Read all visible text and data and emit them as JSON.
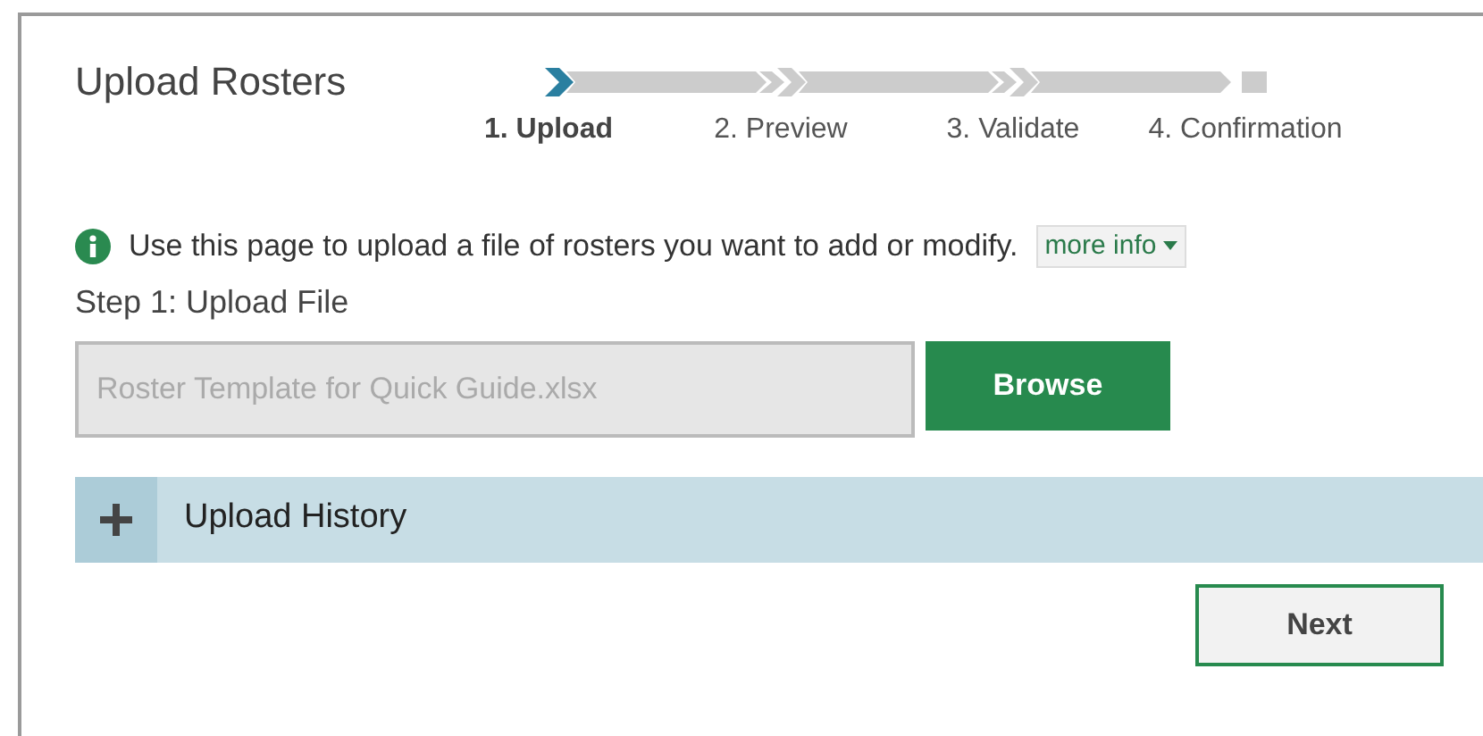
{
  "title": "Upload Rosters",
  "steps": [
    {
      "label": "1. Upload",
      "selected": true
    },
    {
      "label": "2. Preview",
      "selected": false
    },
    {
      "label": "3. Validate",
      "selected": false
    },
    {
      "label": "4. Confirmation",
      "selected": false
    }
  ],
  "info": {
    "text": "Use this page to upload a file of rosters you want to add or modify.",
    "link": "more info"
  },
  "upload": {
    "heading": "Step 1: Upload File",
    "placeholder": "Roster Template for Quick Guide.xlsx",
    "button": "Browse"
  },
  "history": {
    "label": "Upload History",
    "expanded": false
  },
  "next_button": "Next"
}
